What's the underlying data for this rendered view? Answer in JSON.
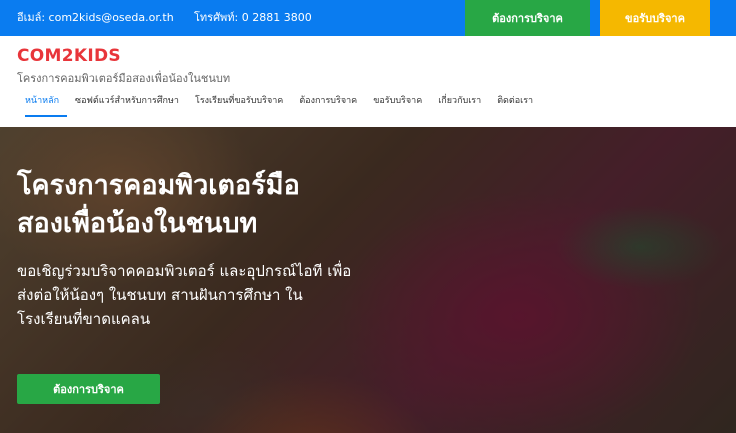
{
  "topbar": {
    "email": "อีเมล์: com2kids@oseda.or.th",
    "phone": "โทรศัพท์: 0 2881 3800",
    "need_button": "ต้องการบริจาค",
    "donate_button": "ขอรับบริจาค"
  },
  "header": {
    "brand": "COM2KIDS",
    "tagline": "โครงการคอมพิวเตอร์มือสองเพื่อน้องในชนบท"
  },
  "nav": {
    "items": [
      {
        "label": "หน้าหลัก"
      },
      {
        "label": "ซอฟต์แวร์สำหรับการศึกษา"
      },
      {
        "label": "โรงเรียนที่ขอรับบริจาค"
      },
      {
        "label": "ต้องการบริจาค"
      },
      {
        "label": "ขอรับบริจาค"
      },
      {
        "label": "เกี่ยวกับเรา"
      },
      {
        "label": "ติดต่อเรา"
      }
    ]
  },
  "hero": {
    "title_line1": "โครงการคอมพิวเตอร์มือ",
    "title_line2": "สองเพื่อน้องในชนบท",
    "subtitle": "ขอเชิญร่วมบริจาคคอมพิวเตอร์ และอุปกรณ์ไอที เพื่อส่งต่อให้น้องๆ ในชนบท สานฝันการศึกษา ในโรงเรียนที่ขาดแคลน",
    "cta": "ต้องการบริจาค"
  },
  "colors": {
    "topbar": "#0a7cf0",
    "need_button": "#28a745",
    "donate_button": "#f5b800",
    "brand": "#e8353a"
  }
}
